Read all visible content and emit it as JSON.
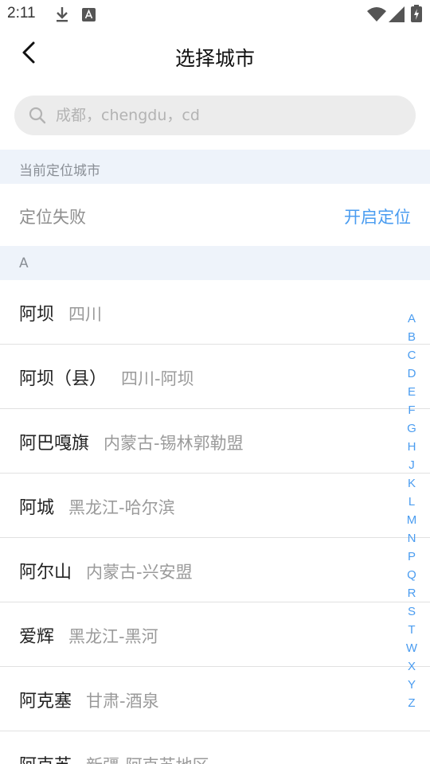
{
  "status_bar": {
    "time": "2:11",
    "icons": [
      "download-icon",
      "a-box-icon",
      "wifi-icon",
      "signal-icon",
      "battery-charging-icon"
    ]
  },
  "header": {
    "title": "选择城市",
    "back_icon": "chevron-left-icon"
  },
  "search": {
    "value": "",
    "placeholder": "成都，chengdu，cd"
  },
  "current_location": {
    "section_title": "当前定位城市",
    "status": "定位失败",
    "action": "开启定位"
  },
  "letter_section": {
    "title": "A"
  },
  "cities": [
    {
      "name": "阿坝",
      "region": "四川"
    },
    {
      "name": "阿坝（县）",
      "region": "四川-阿坝"
    },
    {
      "name": "阿巴嘎旗",
      "region": "内蒙古-锡林郭勒盟"
    },
    {
      "name": "阿城",
      "region": "黑龙江-哈尔滨"
    },
    {
      "name": "阿尔山",
      "region": "内蒙古-兴安盟"
    },
    {
      "name": "爱辉",
      "region": "黑龙江-黑河"
    },
    {
      "name": "阿克塞",
      "region": "甘肃-酒泉"
    },
    {
      "name": "阿克苏",
      "region": "新疆-阿克苏地区"
    }
  ],
  "index_letters": [
    "A",
    "B",
    "C",
    "D",
    "E",
    "F",
    "G",
    "H",
    "J",
    "K",
    "L",
    "M",
    "N",
    "P",
    "Q",
    "R",
    "S",
    "T",
    "W",
    "X",
    "Y",
    "Z"
  ],
  "colors": {
    "accent": "#4a9cf0",
    "section_bg": "#eef3fa",
    "search_bg": "#ececec"
  }
}
